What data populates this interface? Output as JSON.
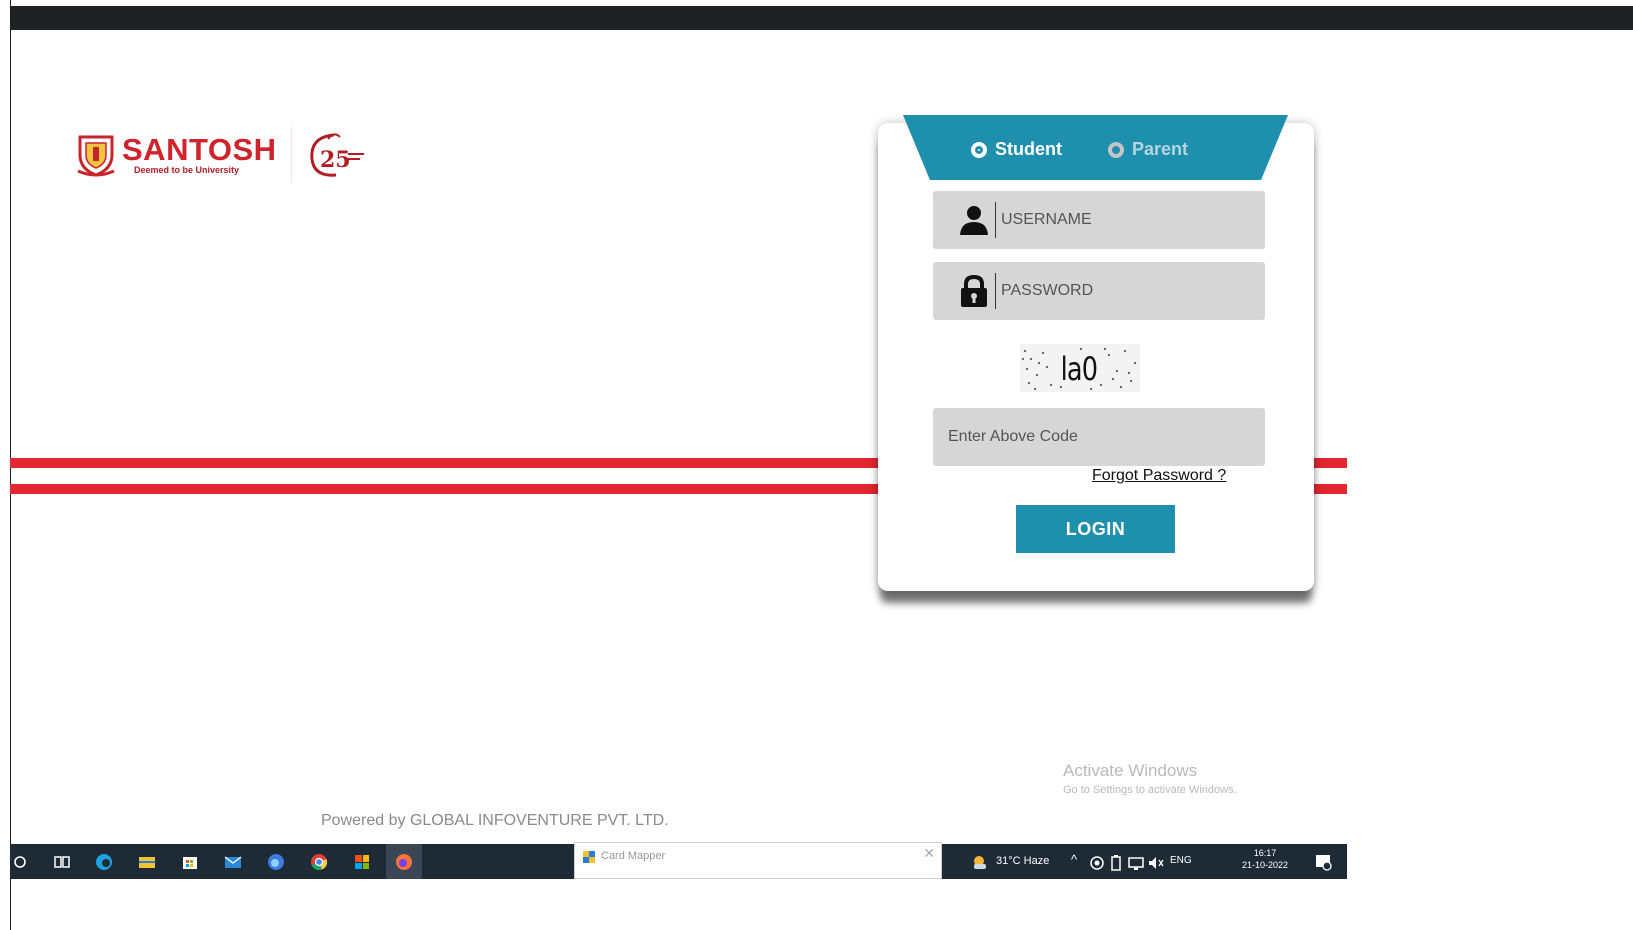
{
  "logo": {
    "name": "SANTOSH",
    "subtitle": "Deemed to be University"
  },
  "login_form": {
    "roles": [
      "Student",
      "Parent"
    ],
    "selected_role": "Student",
    "username_placeholder": "USERNAME",
    "password_placeholder": "PASSWORD",
    "captcha_text": "la0",
    "code_placeholder": "Enter Above Code",
    "forgot_label": "Forgot Password ?",
    "login_label": "LOGIN"
  },
  "footer": {
    "powered_by": "Powered by GLOBAL INFOVENTURE PVT. LTD."
  },
  "watermark": {
    "title": "Activate Windows",
    "subtitle": "Go to Settings to activate Windows."
  },
  "taskbar": {
    "window_title": "Card Mapper",
    "weather": "31°C  Haze",
    "language": "ENG",
    "time": "16:17",
    "date": "21-10-2022"
  },
  "colors": {
    "accent": "#1f8fae",
    "brand_red": "#e3262f"
  }
}
